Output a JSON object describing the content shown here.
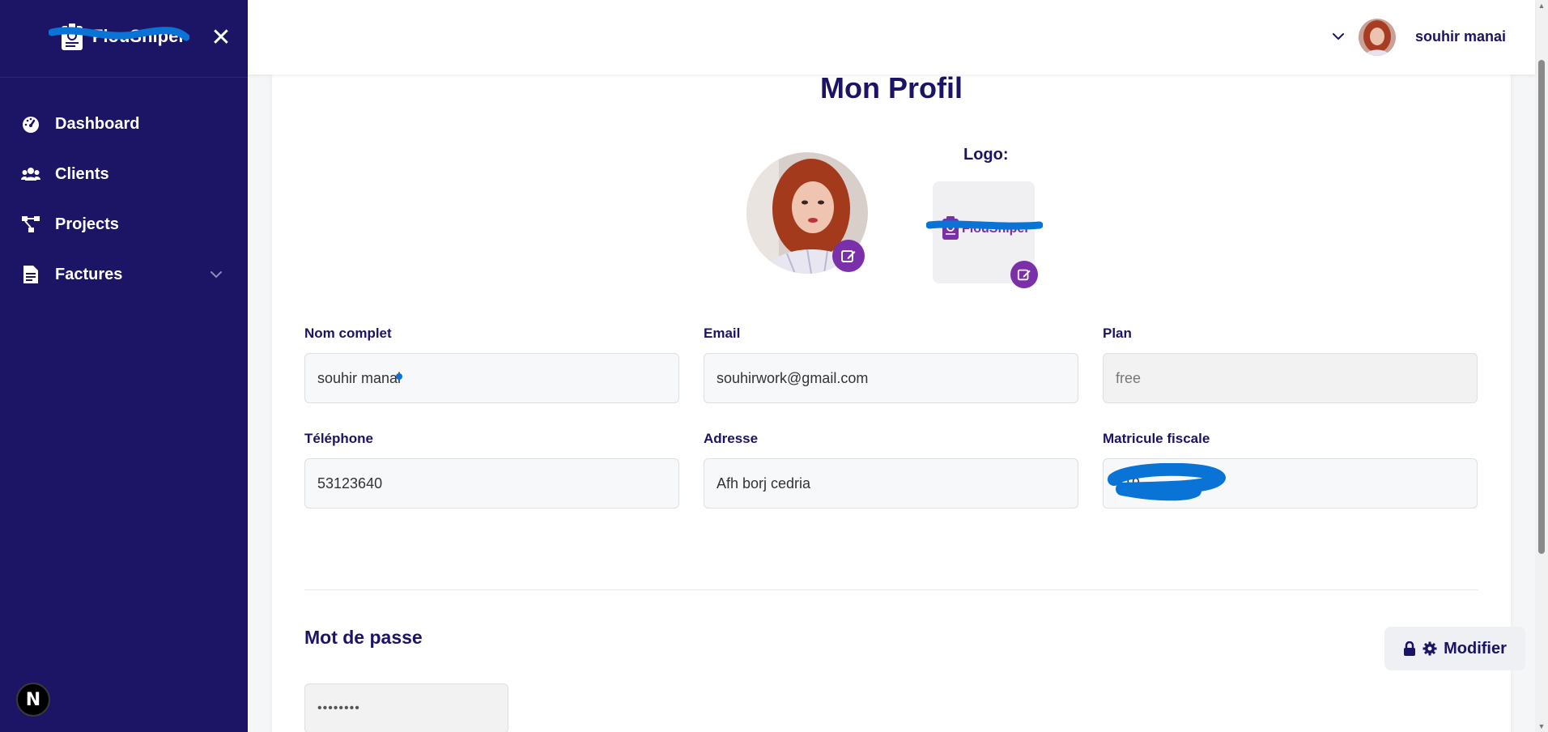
{
  "sidebar": {
    "brand_name": "FlouSniper",
    "items": [
      {
        "label": "Dashboard"
      },
      {
        "label": "Clients"
      },
      {
        "label": "Projects"
      },
      {
        "label": "Factures"
      }
    ],
    "framework_badge": "N"
  },
  "header": {
    "user_name": "souhir manai"
  },
  "profile": {
    "title": "Mon Profil",
    "logo_label": "Logo:",
    "logo_text": "FlouSniper",
    "fields": {
      "name": {
        "label": "Nom complet",
        "value": "souhir manai"
      },
      "email": {
        "label": "Email",
        "value": "souhirwork@gmail.com"
      },
      "plan": {
        "label": "Plan",
        "value": "free"
      },
      "phone": {
        "label": "Téléphone",
        "value": "53123640"
      },
      "address": {
        "label": "Adresse",
        "value": "Afh borj cedria"
      },
      "tax_id": {
        "label": "Matricule fiscale",
        "value": "519"
      }
    },
    "password": {
      "title": "Mot de passe",
      "modify_label": "Modifier",
      "masked_value": "••••••••"
    }
  },
  "colors": {
    "sidebar_bg": "#1c1465",
    "primary_text": "#1b1464",
    "accent_purple": "#7b2fa8",
    "redaction_blue": "#0a74d6"
  }
}
